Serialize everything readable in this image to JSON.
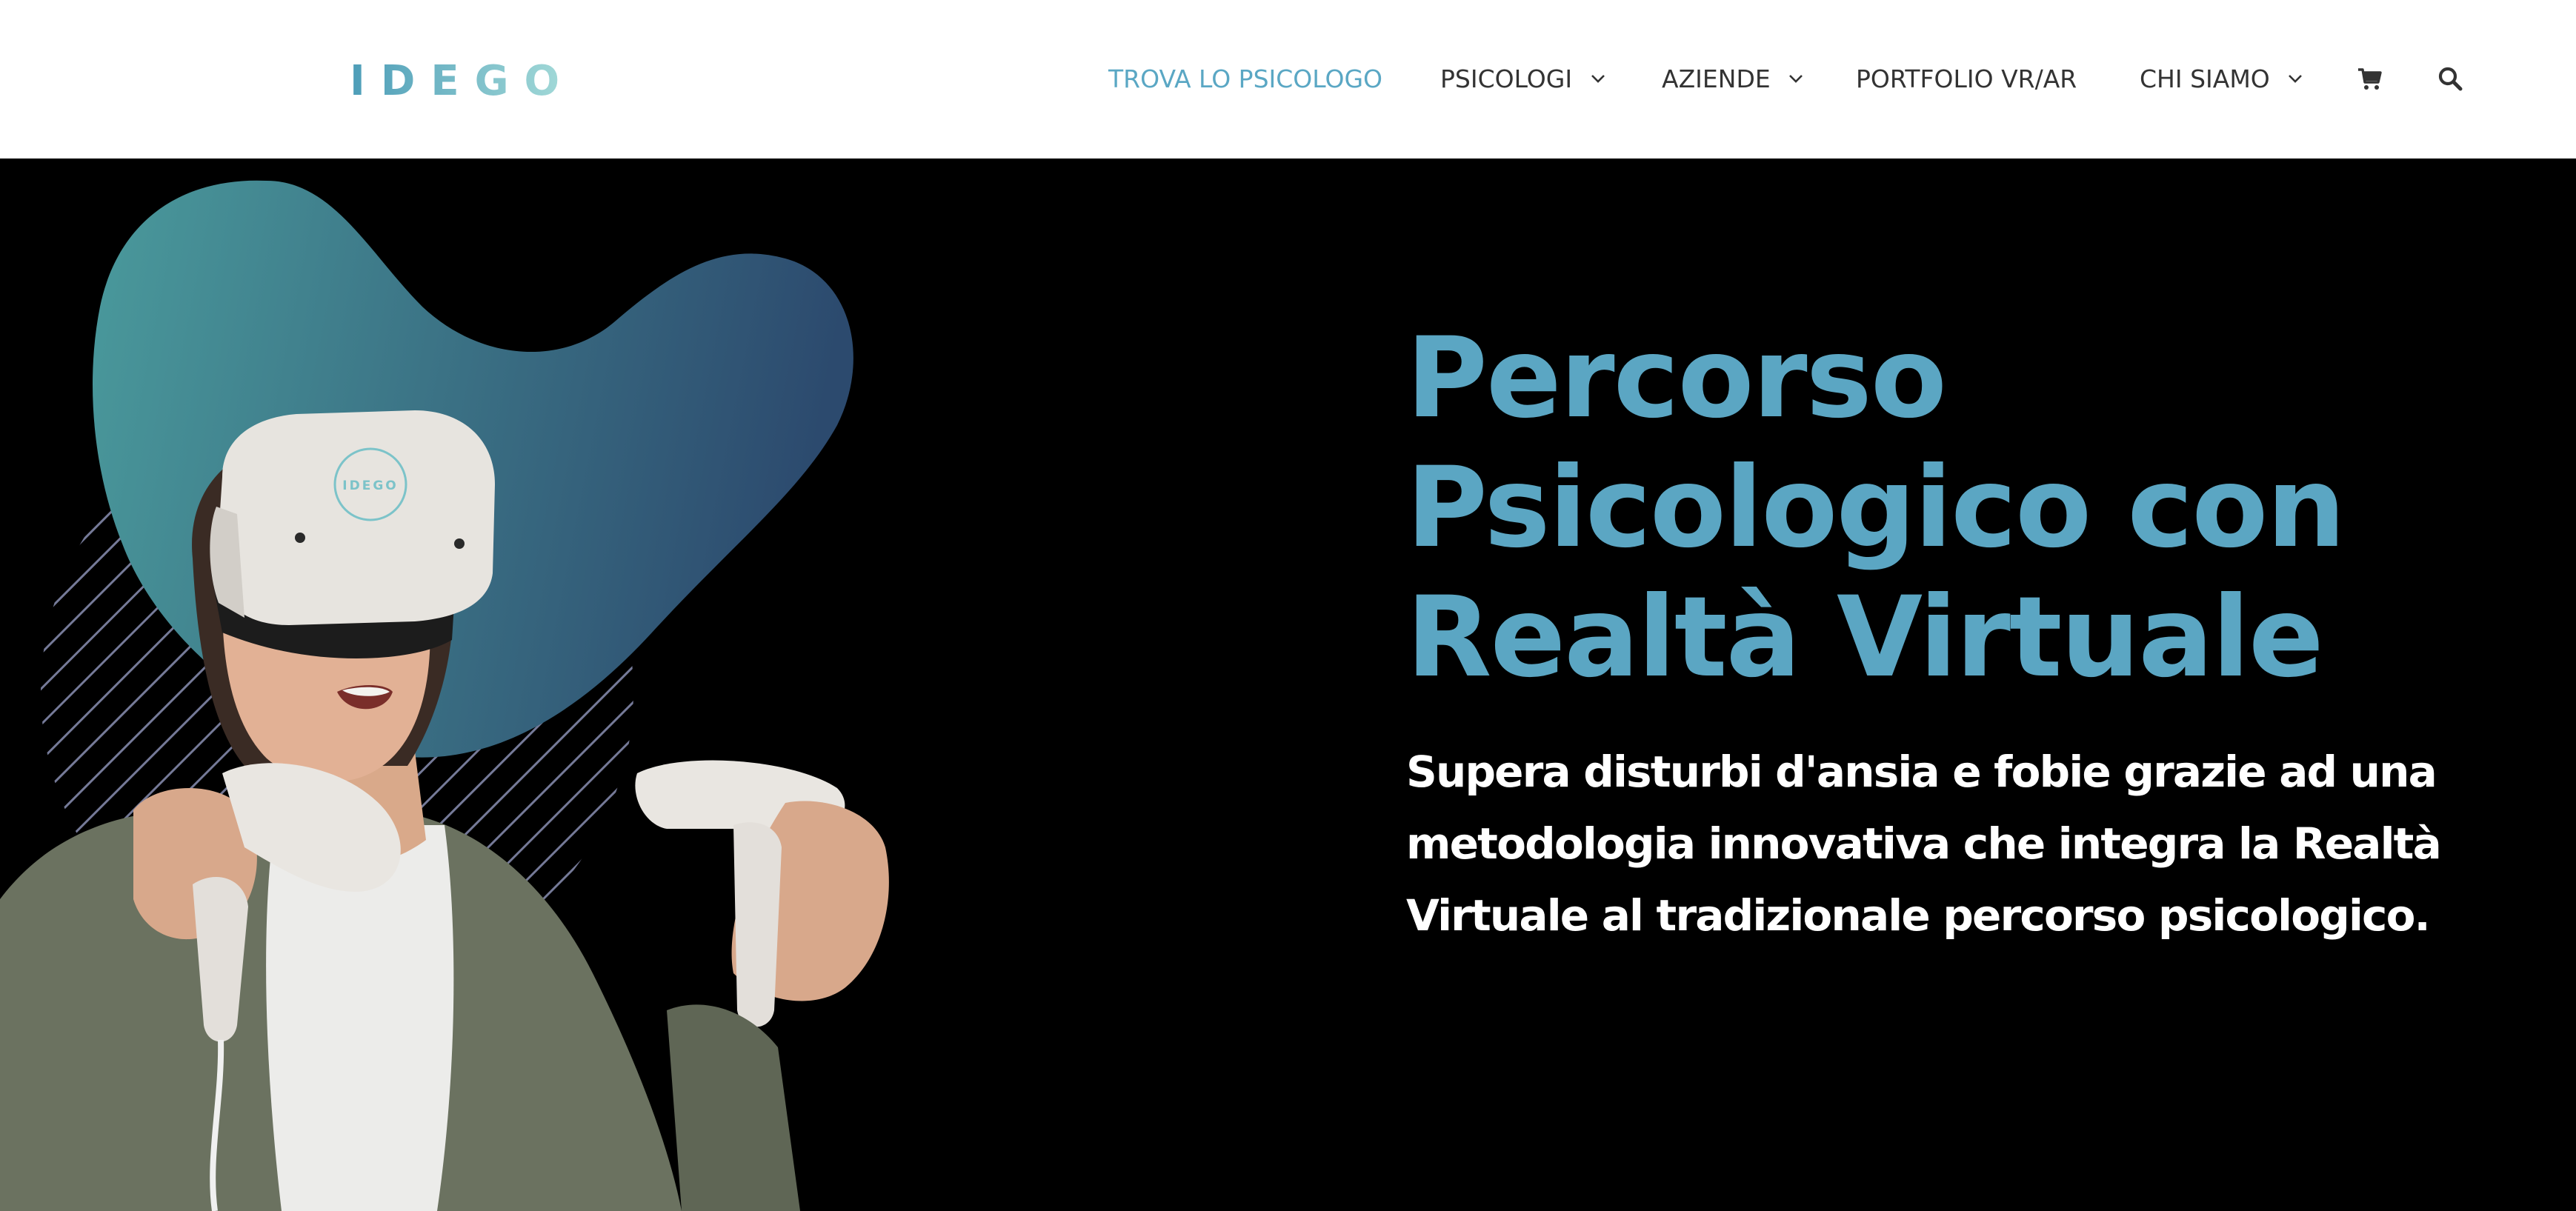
{
  "header": {
    "logo_text": "IDEGO",
    "nav": [
      {
        "label": "TROVA LO PSICOLOGO",
        "active": true,
        "has_dropdown": false
      },
      {
        "label": "PSICOLOGI",
        "active": false,
        "has_dropdown": true
      },
      {
        "label": "AZIENDE",
        "active": false,
        "has_dropdown": true
      },
      {
        "label": "PORTFOLIO VR/AR",
        "active": false,
        "has_dropdown": false
      },
      {
        "label": "CHI SIAMO",
        "active": false,
        "has_dropdown": true
      }
    ],
    "icons": [
      "cart-icon",
      "search-icon"
    ]
  },
  "hero": {
    "headline": [
      "Percorso",
      "Psicologico con",
      "Realtà Virtuale"
    ],
    "subtitle": "Supera disturbi d'ansia e fobie grazie ad una metodologia innovativa che integra la Realtà Virtuale al tradizionale percorso psicologico.",
    "headset_brand": "IDEGO"
  },
  "colors": {
    "accent": "#5ba6c3",
    "nav_active": "#5aa7c4",
    "nav_text": "#333333",
    "hero_bg": "#000000",
    "blob_start": "#4a9a9c",
    "blob_end": "#2c4a6e"
  }
}
